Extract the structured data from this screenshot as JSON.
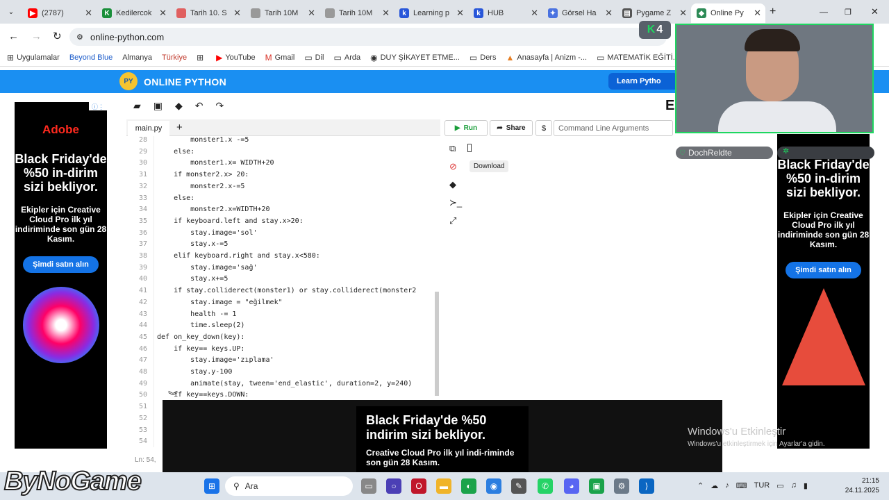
{
  "browser": {
    "tabs": [
      {
        "label": "(2787)",
        "icon": "youtube-icon",
        "color": "#ff0000"
      },
      {
        "label": "Kedilercok",
        "icon": "k-icon",
        "color": "#1a8f3a"
      },
      {
        "label": "Tarih 10. S",
        "icon": "web-icon",
        "color": "#e06060"
      },
      {
        "label": "Tarih 10M",
        "icon": "web-icon",
        "color": "#999999"
      },
      {
        "label": "Tarih 10M",
        "icon": "web-icon",
        "color": "#999999"
      },
      {
        "label": "Learning p",
        "icon": "k-icon",
        "color": "#2856d9"
      },
      {
        "label": "HUB",
        "icon": "k-icon",
        "color": "#2856d9"
      },
      {
        "label": "Görsel Ha",
        "icon": "gemini-icon",
        "color": "#4a72e0"
      },
      {
        "label": "Pygame Z",
        "icon": "doc-icon",
        "color": "#555555"
      },
      {
        "label": "Online Py",
        "icon": "python-icon",
        "color": "#2e8b57"
      }
    ],
    "url": "online-python.com",
    "bookmarks": [
      "Uygulamalar",
      "Beyond Blue",
      "Almanya",
      "Türkiye",
      "YouTube",
      "Gmail",
      "Dil",
      "Arda",
      "DUY ŞİKAYET ETME...",
      "Ders",
      "Anasayfa | Anizm -...",
      "MATEMATİK EĞİTİ..."
    ]
  },
  "site": {
    "logo_text": "PY",
    "title": "ONLINE PYTHON",
    "learn_button": "Learn Pytho"
  },
  "ad_left": {
    "brand": "Adobe",
    "headline": "Black Friday'de %50 in-dirim sizi bekliyor.",
    "body": "Ekipler için Creative Cloud Pro ilk yıl indiriminde son gün 28 Kasım.",
    "cta": "Şimdi satın alın"
  },
  "ad_right": {
    "headline": "Black Friday'de %50 in-dirim sizi bekliyor.",
    "body": "Ekipler için Creative Cloud Pro ilk yıl indiriminde son gün 28 Kasım.",
    "cta": "Şimdi satın alın"
  },
  "editor": {
    "file_tab": "main.py",
    "status": "Ln: 54,",
    "lines": [
      {
        "n": "28",
        "code": "        monster1.x -=5"
      },
      {
        "n": "29",
        "code": "    else:"
      },
      {
        "n": "30",
        "code": "        monster1.x= WIDTH+20"
      },
      {
        "n": "31",
        "code": "    if monster2.x> 20:"
      },
      {
        "n": "32",
        "code": "        monster2.x-=5"
      },
      {
        "n": "33",
        "code": "    else:"
      },
      {
        "n": "34",
        "code": "        monster2.x=WIDTH+20"
      },
      {
        "n": "35",
        "code": "    if keyboard.left and stay.x>20:"
      },
      {
        "n": "36",
        "code": "        stay.image='sol'"
      },
      {
        "n": "37",
        "code": "        stay.x-=5"
      },
      {
        "n": "38",
        "code": "    elif keyboard.right and stay.x<580:"
      },
      {
        "n": "39",
        "code": "        stay.image='sağ'"
      },
      {
        "n": "40",
        "code": "        stay.x+=5"
      },
      {
        "n": "41",
        "code": "    if stay.colliderect(monster1) or stay.colliderect(monster2"
      },
      {
        "n": "42",
        "code": "        stay.image = \"eğilmek\""
      },
      {
        "n": "43",
        "code": "        health -= 1"
      },
      {
        "n": "44",
        "code": "        time.sleep(2)"
      },
      {
        "n": "45",
        "code": "def on_key_down(key):"
      },
      {
        "n": "46",
        "code": "    if key== keys.UP:"
      },
      {
        "n": "47",
        "code": "        stay.image='zıplama'"
      },
      {
        "n": "48",
        "code": "        stay.y-100"
      },
      {
        "n": "49",
        "code": "        animate(stay, tween='end_elastic', duration=2, y=240)"
      },
      {
        "n": "50",
        "code": "    if key==keys.DOWN:"
      },
      {
        "n": "51",
        "code": ""
      },
      {
        "n": "52",
        "code": ""
      },
      {
        "n": "53",
        "code": ""
      },
      {
        "n": "54",
        "code": ""
      }
    ]
  },
  "run_bar": {
    "run": "Run",
    "share": "Share",
    "dollar": "$",
    "cmd_placeholder": "Command Line Arguments",
    "tooltip": "Download"
  },
  "stream": {
    "badge": "4",
    "chat_user": "DochReldte"
  },
  "bottom_ad": {
    "headline": "Black Friday'de %50 indirim sizi bekliyor.",
    "body": "Creative Cloud Pro ilk yıl indi-riminde son gün 28 Kasım."
  },
  "windows": {
    "watermark_title": "Windows'u Etkinleştir",
    "watermark_sub": "Windows'u etkinleştirmek için Ayarlar'a gidin.",
    "search": "Ara",
    "lang": "TUR",
    "time": "21:15",
    "date": "24.11.2025"
  },
  "overlay_logo": "ByNoGame"
}
